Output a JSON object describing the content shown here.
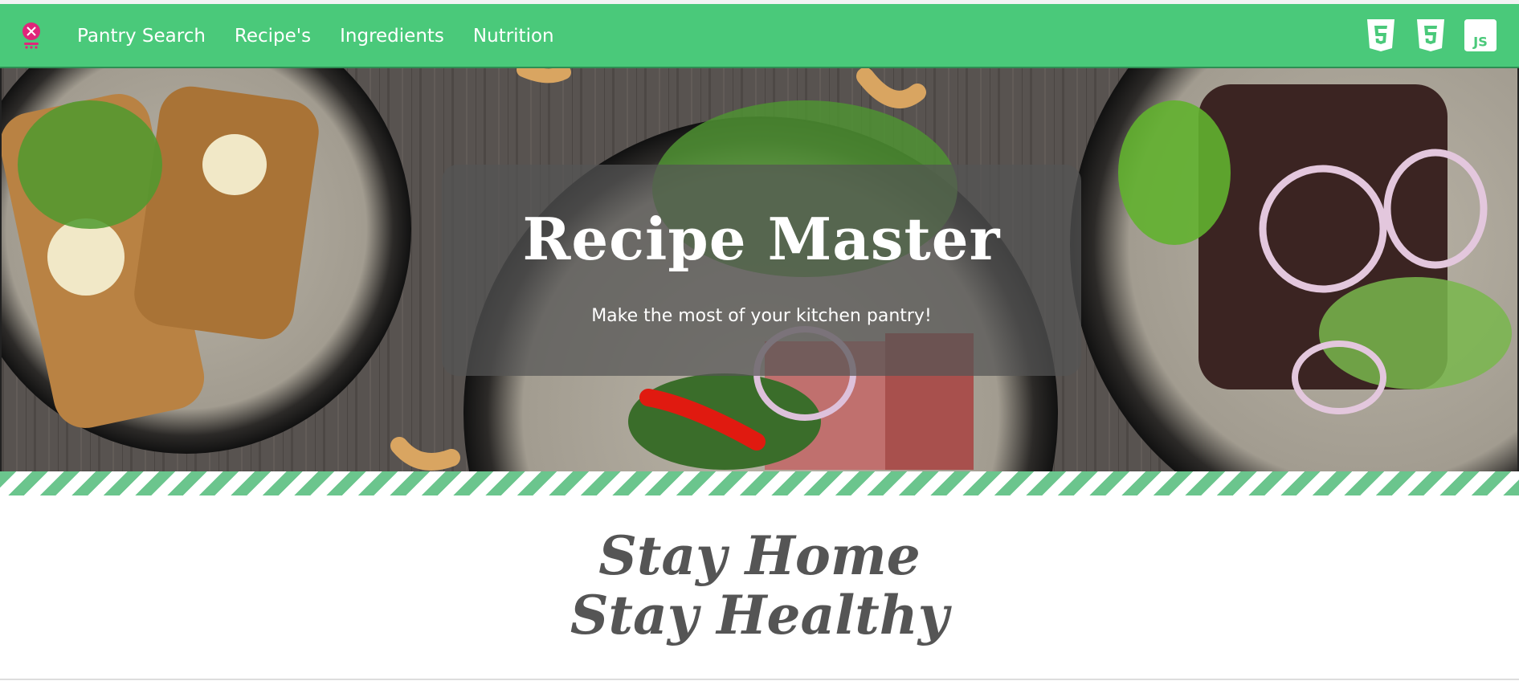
{
  "nav": {
    "logo_icon": "chef-logo-icon",
    "links": [
      {
        "label": "Pantry Search"
      },
      {
        "label": "Recipe's"
      },
      {
        "label": "Ingredients"
      },
      {
        "label": "Nutrition"
      }
    ],
    "tech_icons": [
      "html5-icon",
      "css3-icon",
      "js-icon"
    ],
    "js_label": "JS"
  },
  "hero": {
    "title": "Recipe Master",
    "subtitle": "Make the most of your kitchen pantry!"
  },
  "tagline": {
    "line1": "Stay Home",
    "line2": "Stay Healthy"
  },
  "colors": {
    "brand_green": "#4ac97a",
    "stripe_green": "#6bc58d",
    "logo_pink": "#e0257a"
  }
}
